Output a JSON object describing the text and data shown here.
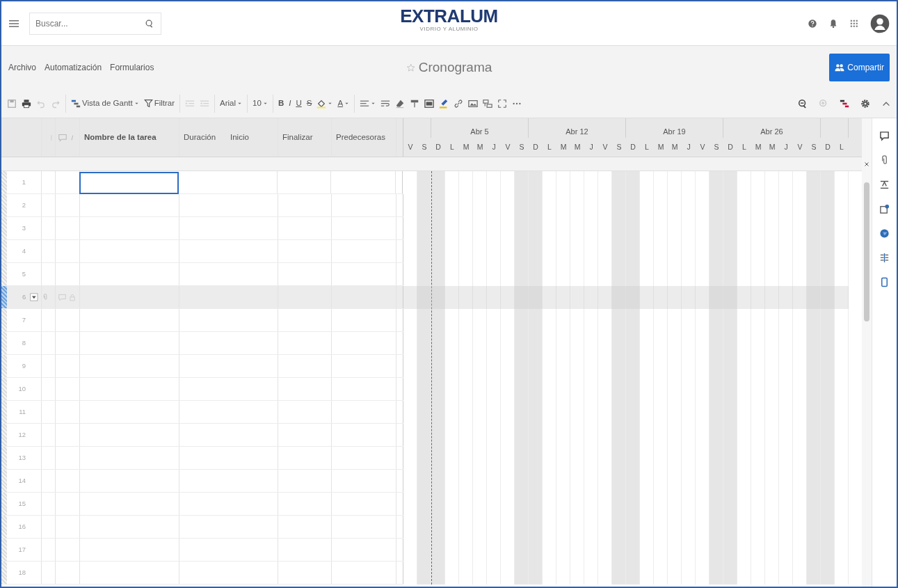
{
  "header": {
    "search": {
      "placeholder": "Buscar..."
    },
    "logo": {
      "name": "EXTRALUM",
      "tagline": "VIDRIO Y ALUMINIO"
    }
  },
  "menu": [
    "Archivo",
    "Automatización",
    "Formularios"
  ],
  "sheet": {
    "title": "Cronograma",
    "favorite": false
  },
  "share_button": "Compartir",
  "toolbar": {
    "gantt_view": "Vista de Gantt",
    "filter": "Filtrar",
    "font": "Arial",
    "font_size": "10",
    "bold": "B",
    "italic": "I",
    "underline": "U",
    "strike": "S",
    "text_color": "A"
  },
  "columns": [
    "Nombre de la tarea",
    "Duración",
    "Inicio",
    "Finalizar",
    "Predecesoras"
  ],
  "gantt": {
    "weeks": [
      {
        "label": "Abr 5"
      },
      {
        "label": "Abr 12"
      },
      {
        "label": "Abr 19"
      },
      {
        "label": "Abr 26"
      }
    ],
    "days": [
      {
        "label": "V",
        "weekend": false,
        "today": false
      },
      {
        "label": "S",
        "weekend": true,
        "today": false
      },
      {
        "label": "D",
        "weekend": true,
        "today": true
      },
      {
        "label": "L",
        "weekend": false,
        "today": false
      },
      {
        "label": "M",
        "weekend": false,
        "today": false
      },
      {
        "label": "M",
        "weekend": false,
        "today": false
      },
      {
        "label": "J",
        "weekend": false,
        "today": false
      },
      {
        "label": "V",
        "weekend": false,
        "today": false
      },
      {
        "label": "S",
        "weekend": true,
        "today": false
      },
      {
        "label": "D",
        "weekend": true,
        "today": false
      },
      {
        "label": "L",
        "weekend": false,
        "today": false
      },
      {
        "label": "M",
        "weekend": false,
        "today": false
      },
      {
        "label": "M",
        "weekend": false,
        "today": false
      },
      {
        "label": "J",
        "weekend": false,
        "today": false
      },
      {
        "label": "V",
        "weekend": false,
        "today": false
      },
      {
        "label": "S",
        "weekend": true,
        "today": false
      },
      {
        "label": "D",
        "weekend": true,
        "today": false
      },
      {
        "label": "L",
        "weekend": false,
        "today": false
      },
      {
        "label": "M",
        "weekend": false,
        "today": false
      },
      {
        "label": "M",
        "weekend": false,
        "today": false
      },
      {
        "label": "J",
        "weekend": false,
        "today": false
      },
      {
        "label": "V",
        "weekend": false,
        "today": false
      },
      {
        "label": "S",
        "weekend": true,
        "today": false
      },
      {
        "label": "D",
        "weekend": true,
        "today": false
      },
      {
        "label": "L",
        "weekend": false,
        "today": false
      },
      {
        "label": "M",
        "weekend": false,
        "today": false
      },
      {
        "label": "M",
        "weekend": false,
        "today": false
      },
      {
        "label": "J",
        "weekend": false,
        "today": false
      },
      {
        "label": "V",
        "weekend": false,
        "today": false
      },
      {
        "label": "S",
        "weekend": true,
        "today": false
      },
      {
        "label": "D",
        "weekend": true,
        "today": false
      },
      {
        "label": "L",
        "weekend": false,
        "today": false
      }
    ]
  },
  "rows": [
    {
      "number": "1",
      "selected": false,
      "focused": true
    },
    {
      "number": "2",
      "selected": false,
      "focused": false
    },
    {
      "number": "3",
      "selected": false,
      "focused": false
    },
    {
      "number": "4",
      "selected": false,
      "focused": false
    },
    {
      "number": "5",
      "selected": false,
      "focused": false
    },
    {
      "number": "6",
      "selected": true,
      "focused": false
    },
    {
      "number": "7",
      "selected": false,
      "focused": false
    },
    {
      "number": "8",
      "selected": false,
      "focused": false
    },
    {
      "number": "9",
      "selected": false,
      "focused": false
    },
    {
      "number": "10",
      "selected": false,
      "focused": false
    },
    {
      "number": "11",
      "selected": false,
      "focused": false
    },
    {
      "number": "12",
      "selected": false,
      "focused": false
    },
    {
      "number": "13",
      "selected": false,
      "focused": false
    },
    {
      "number": "14",
      "selected": false,
      "focused": false
    },
    {
      "number": "15",
      "selected": false,
      "focused": false
    },
    {
      "number": "16",
      "selected": false,
      "focused": false
    },
    {
      "number": "17",
      "selected": false,
      "focused": false
    },
    {
      "number": "18",
      "selected": false,
      "focused": false
    }
  ]
}
